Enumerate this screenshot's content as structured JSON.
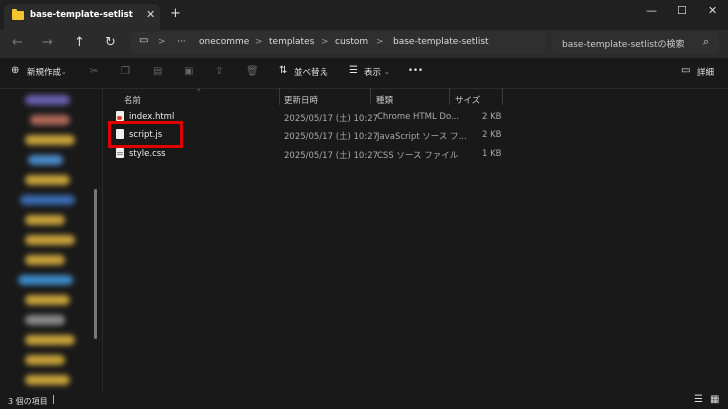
{
  "window": {
    "tab_title": "base-template-setlist"
  },
  "address": {
    "segments": [
      "onecomme",
      "templates",
      "custom",
      "base-template-setlist"
    ],
    "separator": ">",
    "ellipsis": "···"
  },
  "search": {
    "placeholder": "base-template-setlistの検索"
  },
  "toolbar": {
    "new_label": "新規作成",
    "sort_label": "並べ替え",
    "view_label": "表示",
    "more_label": "•••",
    "details_label": "詳細"
  },
  "columns": {
    "name": "名前",
    "date": "更新日時",
    "type": "種類",
    "size": "サイズ"
  },
  "files": [
    {
      "name": "index.html",
      "date": "2025/05/17 (土) 10:27",
      "type": "Chrome HTML Do...",
      "size": "2 KB",
      "icon": "html-file-icon"
    },
    {
      "name": "script.js",
      "date": "2025/05/17 (土) 10:27",
      "type": "JavaScript ソース フ...",
      "size": "2 KB",
      "icon": "js-file-icon"
    },
    {
      "name": "style.css",
      "date": "2025/05/17 (土) 10:27",
      "type": "CSS ソース ファイル",
      "size": "1 KB",
      "icon": "css-file-icon"
    }
  ],
  "status": {
    "item_count": "3 個の項目"
  },
  "colors": {
    "background": "#191919",
    "titlebar": "#202020",
    "highlight": "#e00000",
    "folder": "#f4c430"
  }
}
